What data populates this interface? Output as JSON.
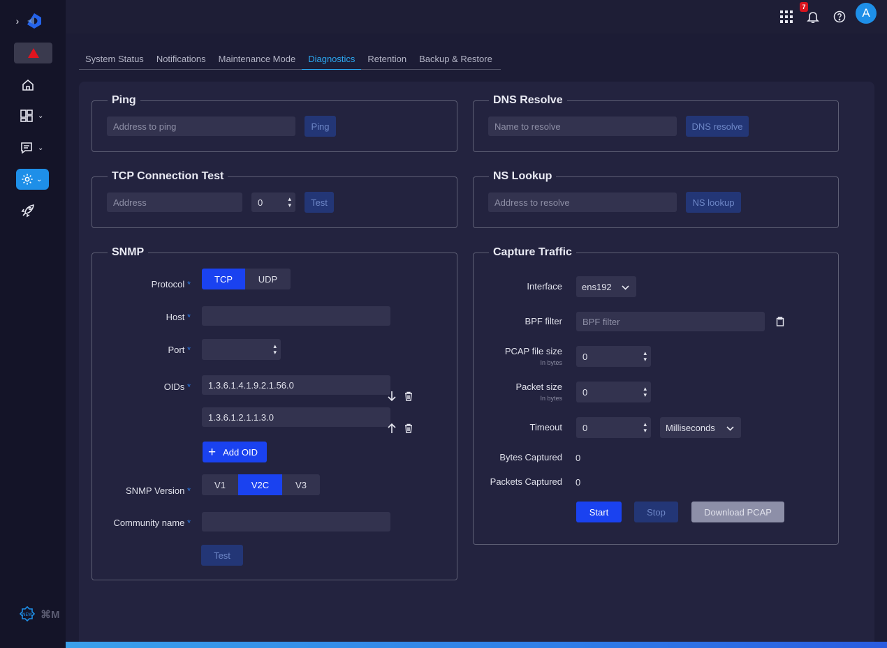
{
  "sidebar": {
    "shortcut": "⌘M"
  },
  "topbar": {
    "notification_count": "7",
    "avatar_initial": "A"
  },
  "tabs": [
    {
      "label": "System Status"
    },
    {
      "label": "Notifications"
    },
    {
      "label": "Maintenance Mode"
    },
    {
      "label": "Diagnostics"
    },
    {
      "label": "Retention"
    },
    {
      "label": "Backup & Restore"
    }
  ],
  "active_tab": "Diagnostics",
  "ping": {
    "title": "Ping",
    "placeholder": "Address to ping",
    "button": "Ping"
  },
  "dns": {
    "title": "DNS Resolve",
    "placeholder": "Name to resolve",
    "button": "DNS resolve"
  },
  "tcp": {
    "title": "TCP Connection Test",
    "placeholder": "Address",
    "port_value": "0",
    "button": "Test"
  },
  "ns": {
    "title": "NS Lookup",
    "placeholder": "Address to resolve",
    "button": "NS lookup"
  },
  "snmp": {
    "title": "SNMP",
    "protocol_label": "Protocol",
    "protocol_options": [
      "TCP",
      "UDP"
    ],
    "protocol_selected": "TCP",
    "host_label": "Host",
    "host_value": "",
    "port_label": "Port",
    "port_value": "",
    "oids_label": "OIDs",
    "oids": [
      "1.3.6.1.4.1.9.2.1.56.0",
      "1.3.6.1.2.1.1.3.0"
    ],
    "add_oid": "Add OID",
    "version_label": "SNMP Version",
    "version_options": [
      "V1",
      "V2C",
      "V3"
    ],
    "version_selected": "V2C",
    "community_label": "Community name",
    "community_value": "",
    "test_button": "Test",
    "required_mark": "*"
  },
  "capture": {
    "title": "Capture Traffic",
    "interface_label": "Interface",
    "interface_value": "ens192",
    "bpf_label": "BPF filter",
    "bpf_placeholder": "BPF filter",
    "pcap_size_label": "PCAP file size",
    "pcap_size_hint": "In bytes",
    "pcap_size_value": "0",
    "packet_size_label": "Packet size",
    "packet_size_hint": "In bytes",
    "packet_size_value": "0",
    "timeout_label": "Timeout",
    "timeout_value": "0",
    "timeout_unit": "Milliseconds",
    "bytes_label": "Bytes Captured",
    "bytes_value": "0",
    "packets_label": "Packets Captured",
    "packets_value": "0",
    "start_button": "Start",
    "stop_button": "Stop",
    "download_button": "Download PCAP"
  },
  "colors": {
    "accent": "#1a42f0",
    "active_tab": "#2ba8f2",
    "alert": "#e0141e"
  }
}
